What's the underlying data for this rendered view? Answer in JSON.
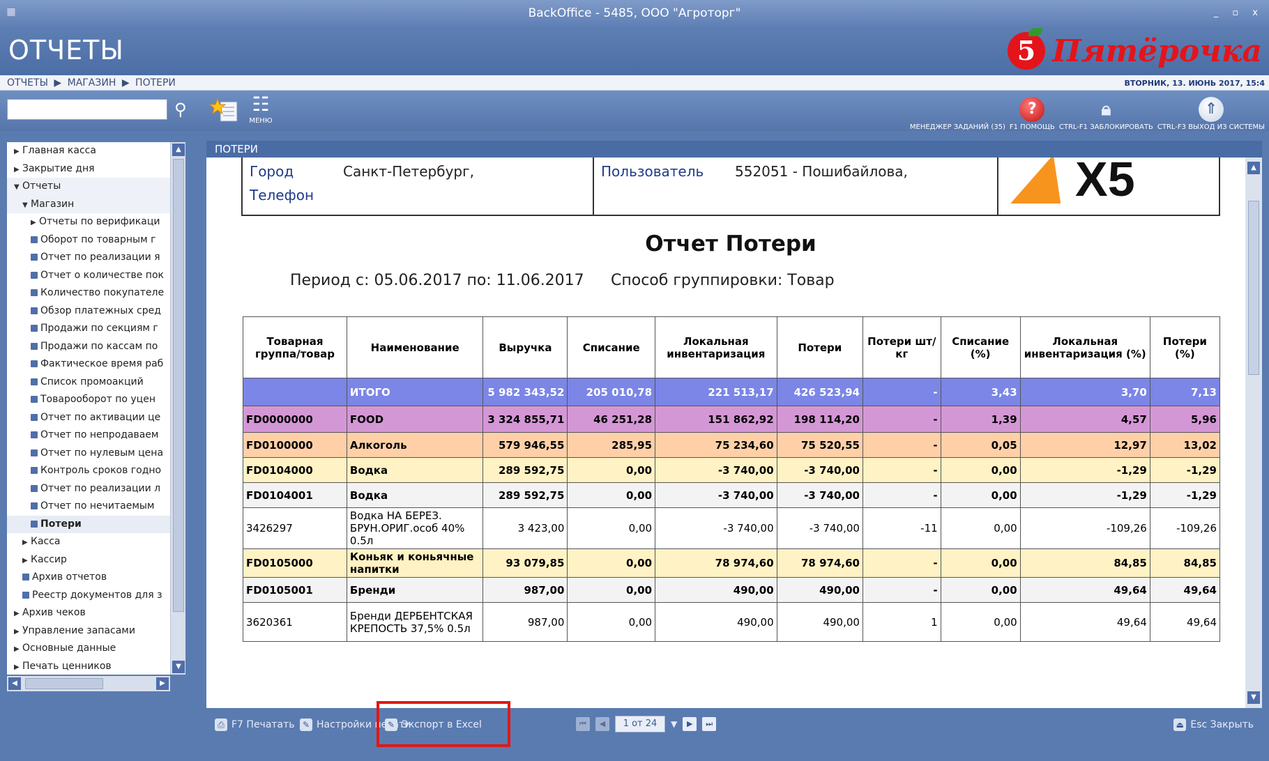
{
  "window": {
    "title": "BackOffice - 5485, ООО \"Агроторг\"",
    "controls": "_ ▫ x"
  },
  "header": {
    "section_title": "ОТЧЕТЫ",
    "brand": "Пятёрочка",
    "brand_mark": "5"
  },
  "breadcrumb": {
    "items": [
      "ОТЧЕТЫ",
      "МАГАЗИН",
      "ПОТЕРИ"
    ],
    "separator": "▶",
    "datetime": "ВТОРНИК, 13. ИЮНЬ 2017, 15:4"
  },
  "toolbar": {
    "search_placeholder": "",
    "menu_label": "МЕНЮ",
    "task_manager": "МЕНЕДЖЕР ЗАДАНИЙ (35)",
    "help": "F1 ПОМОЩЬ",
    "lock": "CTRL-F1 ЗАБЛОКИРОВАТЬ",
    "exit": "CTRL-F3 ВЫХОД ИЗ СИСТЕМЫ"
  },
  "tree": {
    "items": [
      {
        "label": "Главная касса",
        "level": 0,
        "type": "collapsed"
      },
      {
        "label": "Закрытие дня",
        "level": 0,
        "type": "collapsed"
      },
      {
        "label": "Отчеты",
        "level": 0,
        "type": "expanded"
      },
      {
        "label": "Магазин",
        "level": 1,
        "type": "expanded"
      },
      {
        "label": "Отчеты по верификаци",
        "level": 2,
        "type": "collapsed"
      },
      {
        "label": "Оборот по товарным г",
        "level": 2,
        "type": "doc"
      },
      {
        "label": "Отчет по реализации я",
        "level": 2,
        "type": "doc"
      },
      {
        "label": "Отчет о количестве пок",
        "level": 2,
        "type": "doc"
      },
      {
        "label": "Количество покупателе",
        "level": 2,
        "type": "doc"
      },
      {
        "label": "Обзор платежных сред",
        "level": 2,
        "type": "doc"
      },
      {
        "label": "Продажи по секциям г",
        "level": 2,
        "type": "doc"
      },
      {
        "label": "Продажи по кассам по",
        "level": 2,
        "type": "doc"
      },
      {
        "label": "Фактическое время раб",
        "level": 2,
        "type": "doc"
      },
      {
        "label": "Список промоакций",
        "level": 2,
        "type": "doc"
      },
      {
        "label": "Товарооборот по уцен",
        "level": 2,
        "type": "doc"
      },
      {
        "label": "Отчет по активации це",
        "level": 2,
        "type": "doc"
      },
      {
        "label": "Отчет по непродаваем",
        "level": 2,
        "type": "doc"
      },
      {
        "label": "Отчет по нулевым цена",
        "level": 2,
        "type": "doc"
      },
      {
        "label": "Контроль сроков годно",
        "level": 2,
        "type": "doc"
      },
      {
        "label": "Отчет по реализации л",
        "level": 2,
        "type": "doc"
      },
      {
        "label": "Отчет по нечитаемым",
        "level": 2,
        "type": "doc"
      },
      {
        "label": "Потери",
        "level": 2,
        "type": "doc",
        "selected": true
      },
      {
        "label": "Касса",
        "level": 1,
        "type": "collapsed"
      },
      {
        "label": "Кассир",
        "level": 1,
        "type": "collapsed"
      },
      {
        "label": "Архив отчетов",
        "level": 1,
        "type": "doc"
      },
      {
        "label": "Реестр документов для з",
        "level": 1,
        "type": "doc"
      },
      {
        "label": "Архив чеков",
        "level": 0,
        "type": "collapsed"
      },
      {
        "label": "Управление запасами",
        "level": 0,
        "type": "collapsed"
      },
      {
        "label": "Основные данные",
        "level": 0,
        "type": "collapsed"
      },
      {
        "label": "Печать ценников",
        "level": 0,
        "type": "collapsed"
      }
    ]
  },
  "report": {
    "panel_title": "ПОТЕРИ",
    "city_label": "Город",
    "city_value": "Санкт-Петербург,",
    "phone_label": "Телефон",
    "user_label": "Пользователь",
    "user_value": "552051 - Пошибайлова,",
    "logo_text": "X5",
    "title": "Отчет Потери",
    "period": "Период с: 05.06.2017  по: 11.06.2017",
    "grouping": "Способ группировки: Товар",
    "columns": [
      "Товарная группа/товар",
      "Наименование",
      "Выручка",
      "Списание",
      "Локальная инвентаризация",
      "Потери",
      "Потери шт/кг",
      "Списание (%)",
      "Локальная инвентаризация (%)",
      "Потери (%)"
    ],
    "rows": [
      {
        "style": "total",
        "cells": [
          "",
          "ИТОГО",
          "5 982 343,52",
          "205 010,78",
          "221 513,17",
          "426 523,94",
          "-",
          "3,43",
          "3,70",
          "7,13"
        ]
      },
      {
        "style": "food",
        "cells": [
          "FD0000000",
          "FOOD",
          "3 324 855,71",
          "46 251,28",
          "151 862,92",
          "198 114,20",
          "-",
          "1,39",
          "4,57",
          "5,96"
        ]
      },
      {
        "style": "alco",
        "cells": [
          "FD0100000",
          "Алкоголь",
          "579 946,55",
          "285,95",
          "75 234,60",
          "75 520,55",
          "-",
          "0,05",
          "12,97",
          "13,02"
        ]
      },
      {
        "style": "vodka",
        "cells": [
          "FD0104000",
          "Водка",
          "289 592,75",
          "0,00",
          "-3 740,00",
          "-3 740,00",
          "-",
          "0,00",
          "-1,29",
          "-1,29"
        ]
      },
      {
        "style": "sub",
        "cells": [
          "FD0104001",
          "Водка",
          "289 592,75",
          "0,00",
          "-3 740,00",
          "-3 740,00",
          "-",
          "0,00",
          "-1,29",
          "-1,29"
        ]
      },
      {
        "style": "item",
        "cells": [
          "3426297",
          "Водка НА БЕРЕЗ. БРУН.ОРИГ.особ 40% 0.5л",
          "3 423,00",
          "0,00",
          "-3 740,00",
          "-3 740,00",
          "-11",
          "0,00",
          "-109,26",
          "-109,26"
        ]
      },
      {
        "style": "vodka",
        "cells": [
          "FD0105000",
          "Коньяк и коньячные напитки",
          "93 079,85",
          "0,00",
          "78 974,60",
          "78 974,60",
          "-",
          "0,00",
          "84,85",
          "84,85"
        ]
      },
      {
        "style": "sub",
        "cells": [
          "FD0105001",
          "Бренди",
          "987,00",
          "0,00",
          "490,00",
          "490,00",
          "-",
          "0,00",
          "49,64",
          "49,64"
        ]
      },
      {
        "style": "item",
        "cells": [
          "3620361",
          "Бренди ДЕРБЕНТСКАЯ КРЕПОСТЬ 37,5% 0.5л",
          "987,00",
          "0,00",
          "490,00",
          "490,00",
          "1",
          "0,00",
          "49,64",
          "49,64"
        ]
      }
    ]
  },
  "bottom": {
    "print": "F7 Печатать",
    "print_settings": "Настройки печати",
    "export_excel": "Экспорт в Excel",
    "page_indicator": "1 от 24",
    "close": "Esc Закрыть"
  },
  "colors": {
    "titlebar": "#6f8ec2",
    "panel": "#5a7bb0",
    "total_row": "#7b86e6",
    "food_row": "#d497d6",
    "alco_row": "#ffd0a8",
    "vodka_row": "#fff2c4",
    "brand_red": "#e4141b",
    "highlight": "#e01818"
  }
}
